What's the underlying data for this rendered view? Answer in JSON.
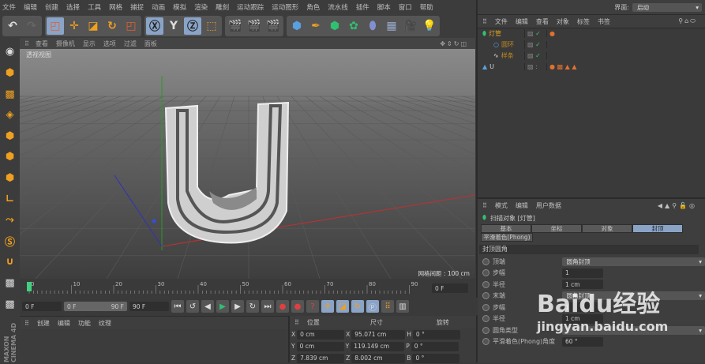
{
  "menu": [
    "文件",
    "编辑",
    "创建",
    "选择",
    "工具",
    "网格",
    "捕捉",
    "动画",
    "模拟",
    "渲染",
    "雕刻",
    "运动跟踪",
    "运动图形",
    "角色",
    "流水线",
    "插件",
    "脚本",
    "窗口",
    "帮助"
  ],
  "layout": {
    "label": "界面:",
    "value": "启动"
  },
  "viewport": {
    "menu": [
      "查看",
      "摄像机",
      "显示",
      "选项",
      "过滤",
      "面板"
    ],
    "view_name": "透视视图",
    "grid_spacing": "网格间距 : 100 cm"
  },
  "objects": {
    "menu": [
      "文件",
      "编辑",
      "查看",
      "对象",
      "标签",
      "书签"
    ],
    "items": [
      {
        "name": "灯管",
        "color": "#e0a020"
      },
      {
        "name": "圆环",
        "color": "#c08a20"
      },
      {
        "name": "样条",
        "color": "#c08a20"
      },
      {
        "name": "U",
        "color": "#cfcfcf"
      }
    ]
  },
  "attributes": {
    "menu": [
      "模式",
      "编辑",
      "用户数据"
    ],
    "title": "扫描对象 [灯管]",
    "tabs": [
      "基本",
      "坐标",
      "对象",
      "封顶"
    ],
    "tab2": "平滑着色(Phong)",
    "section": "封顶圆角",
    "rows": [
      {
        "label": "顶端",
        "value": "圆角封顶",
        "type": "drop"
      },
      {
        "label": "步幅",
        "value": "1",
        "type": "field"
      },
      {
        "label": "半径",
        "value": "1 cm",
        "type": "field"
      },
      {
        "label": "末端",
        "value": "圆角封顶",
        "type": "drop"
      },
      {
        "label": "步幅",
        "value": "1",
        "type": "field"
      },
      {
        "label": "半径",
        "value": "1 cm",
        "type": "field"
      },
      {
        "label": "圆角类型",
        "value": "",
        "type": "drop"
      },
      {
        "label": "平滑着色(Phong)角度",
        "value": "60 °",
        "type": "field"
      }
    ]
  },
  "timeline": {
    "ticks": [
      "0",
      "10",
      "20",
      "30",
      "40",
      "50",
      "60",
      "70",
      "80",
      "90"
    ],
    "current": "0 F",
    "start": "0 F",
    "range_start": "0 F",
    "range_end": "90 F",
    "end": "90 F"
  },
  "materials": {
    "menu": [
      "创建",
      "编辑",
      "功能",
      "纹理"
    ]
  },
  "coords": {
    "headers": [
      "位置",
      "尺寸",
      "旋转"
    ],
    "rows": [
      {
        "a": "X",
        "pos": "0 cm",
        "s": "X",
        "size": "95.071 cm",
        "r": "H",
        "rot": "0 °"
      },
      {
        "a": "Y",
        "pos": "0 cm",
        "s": "Y",
        "size": "119.149 cm",
        "r": "P",
        "rot": "0 °"
      },
      {
        "a": "Z",
        "pos": "7.839 cm",
        "s": "Z",
        "size": "8.002 cm",
        "r": "B",
        "rot": "0 °"
      }
    ]
  },
  "brand": "MAXON CINEMA 4D",
  "watermark": {
    "main": "Baidu经验",
    "url": "jingyan.baidu.com"
  }
}
